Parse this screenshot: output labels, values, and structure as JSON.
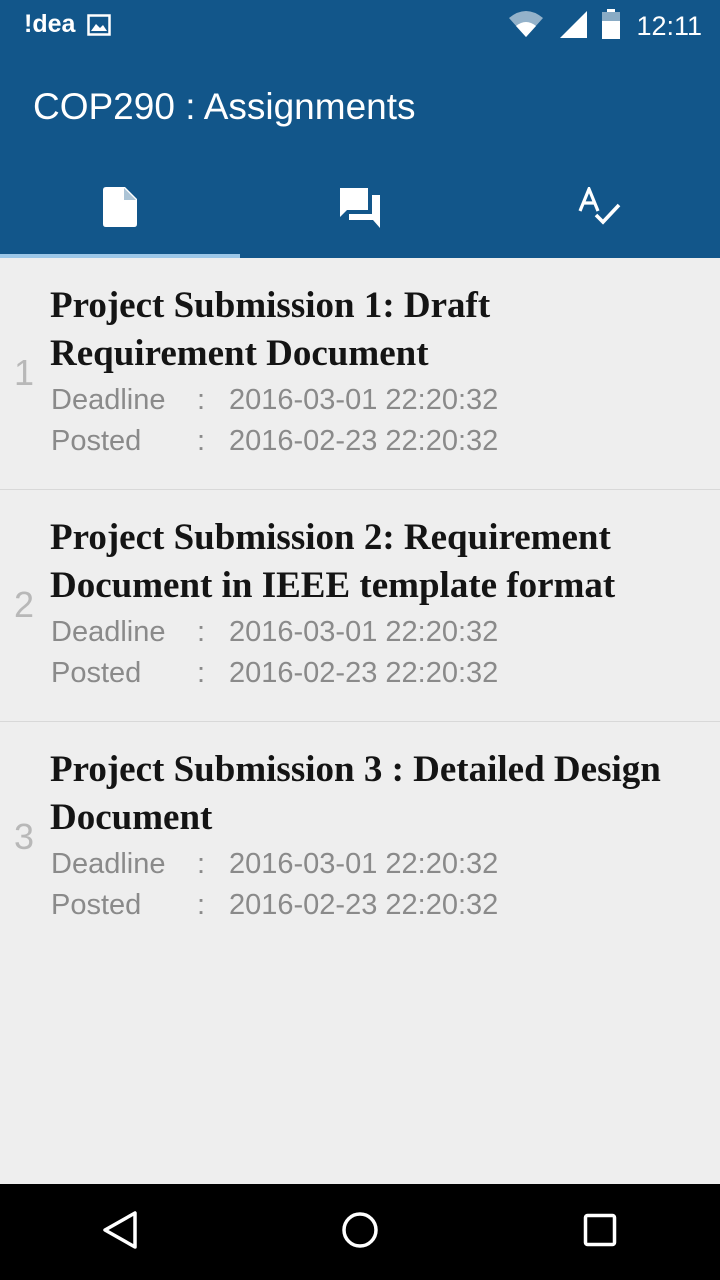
{
  "status_bar": {
    "carrier": "!dea",
    "time": "12:11",
    "icons": [
      "gallery-icon",
      "wifi-icon",
      "signal-icon",
      "battery-icon"
    ]
  },
  "app_bar": {
    "title": "COP290 : Assignments",
    "background_color": "#12568a",
    "tabs": [
      {
        "icon": "document-icon",
        "active": true
      },
      {
        "icon": "forum-icon",
        "active": false
      },
      {
        "icon": "spellcheck-icon",
        "active": false
      }
    ]
  },
  "assignments": [
    {
      "number": "1",
      "title": "Project Submission 1: Draft Requirement Document",
      "deadline_label": "Deadline",
      "deadline_sep": ":",
      "deadline": "2016-03-01 22:20:32",
      "posted_label": "Posted",
      "posted_sep": ":",
      "posted": "2016-02-23 22:20:32"
    },
    {
      "number": "2",
      "title": "Project Submission 2: Requirement Document in IEEE template format",
      "deadline_label": "Deadline",
      "deadline_sep": ":",
      "deadline": "2016-03-01 22:20:32",
      "posted_label": "Posted",
      "posted_sep": ":",
      "posted": "2016-02-23 22:20:32"
    },
    {
      "number": "3",
      "title": "Project Submission 3 : Detailed Design Document",
      "deadline_label": "Deadline",
      "deadline_sep": ":",
      "deadline": "2016-03-01 22:20:32",
      "posted_label": "Posted",
      "posted_sep": ":",
      "posted": "2016-02-23 22:20:32"
    }
  ],
  "nav_bar": {
    "buttons": [
      "back-icon",
      "home-icon",
      "recents-icon"
    ]
  }
}
